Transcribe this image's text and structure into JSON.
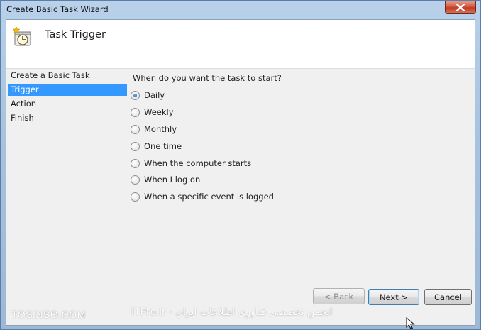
{
  "window": {
    "title": "Create Basic Task Wizard"
  },
  "header": {
    "title": "Task Trigger",
    "icon": "task-clock-icon"
  },
  "nav": {
    "items": [
      {
        "label": "Create a Basic Task",
        "selected": false
      },
      {
        "label": "Trigger",
        "selected": true
      },
      {
        "label": "Action",
        "selected": false
      },
      {
        "label": "Finish",
        "selected": false
      }
    ]
  },
  "content": {
    "question": "When do you want the task to start?",
    "options": [
      {
        "label": "Daily",
        "checked": true
      },
      {
        "label": "Weekly",
        "checked": false
      },
      {
        "label": "Monthly",
        "checked": false
      },
      {
        "label": "One time",
        "checked": false
      },
      {
        "label": "When the computer starts",
        "checked": false
      },
      {
        "label": "When I log on",
        "checked": false
      },
      {
        "label": "When a specific event is logged",
        "checked": false
      }
    ]
  },
  "buttons": {
    "back": "< Back",
    "next": "Next >",
    "cancel": "Cancel"
  },
  "watermark": {
    "left": "TOSINSO.COM",
    "right": "ITPro.ir - انجمن تخصصی فناوری اطلاعات ایران"
  },
  "colors": {
    "selection": "#3399ff",
    "frame": "#a8c3df",
    "close": "#c13d22"
  }
}
